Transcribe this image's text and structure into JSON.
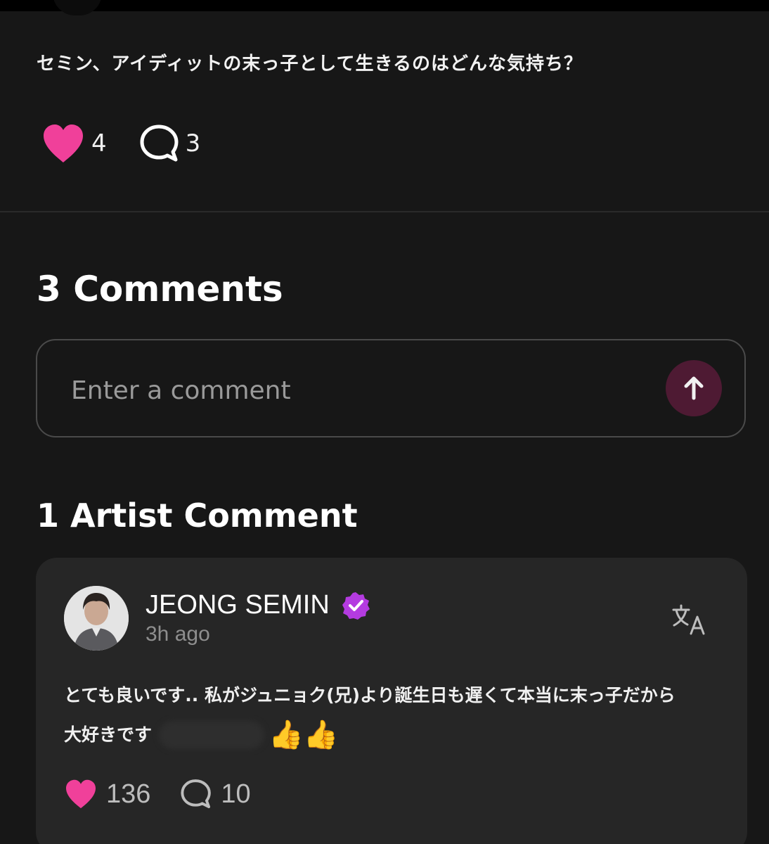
{
  "post": {
    "text": "セミン、アイディットの末っ子として生きるのはどんな気持ち？",
    "likes": "4",
    "comments": "3"
  },
  "comments_section": {
    "title": "3 Comments",
    "input_placeholder": "Enter a comment"
  },
  "artist_section": {
    "title": "1 Artist Comment"
  },
  "artist_comment": {
    "author": "JEONG SEMIN",
    "time": "3h ago",
    "body_line1": "とても良いです.. 私がジュニョク(兄)より誕生日も遅くて本当に末っ子だから",
    "body_line2": "大好きです",
    "emoji": "👍👍",
    "likes": "136",
    "replies": "10"
  },
  "colors": {
    "background": "#171717",
    "heart": "#f0409a",
    "verified_badge": "#b43be0",
    "send_button": "#4e1a33",
    "card": "#262626"
  },
  "icons": [
    "heart-icon",
    "speech-bubble-icon",
    "arrow-up-icon",
    "verified-badge-icon",
    "translate-icon"
  ]
}
